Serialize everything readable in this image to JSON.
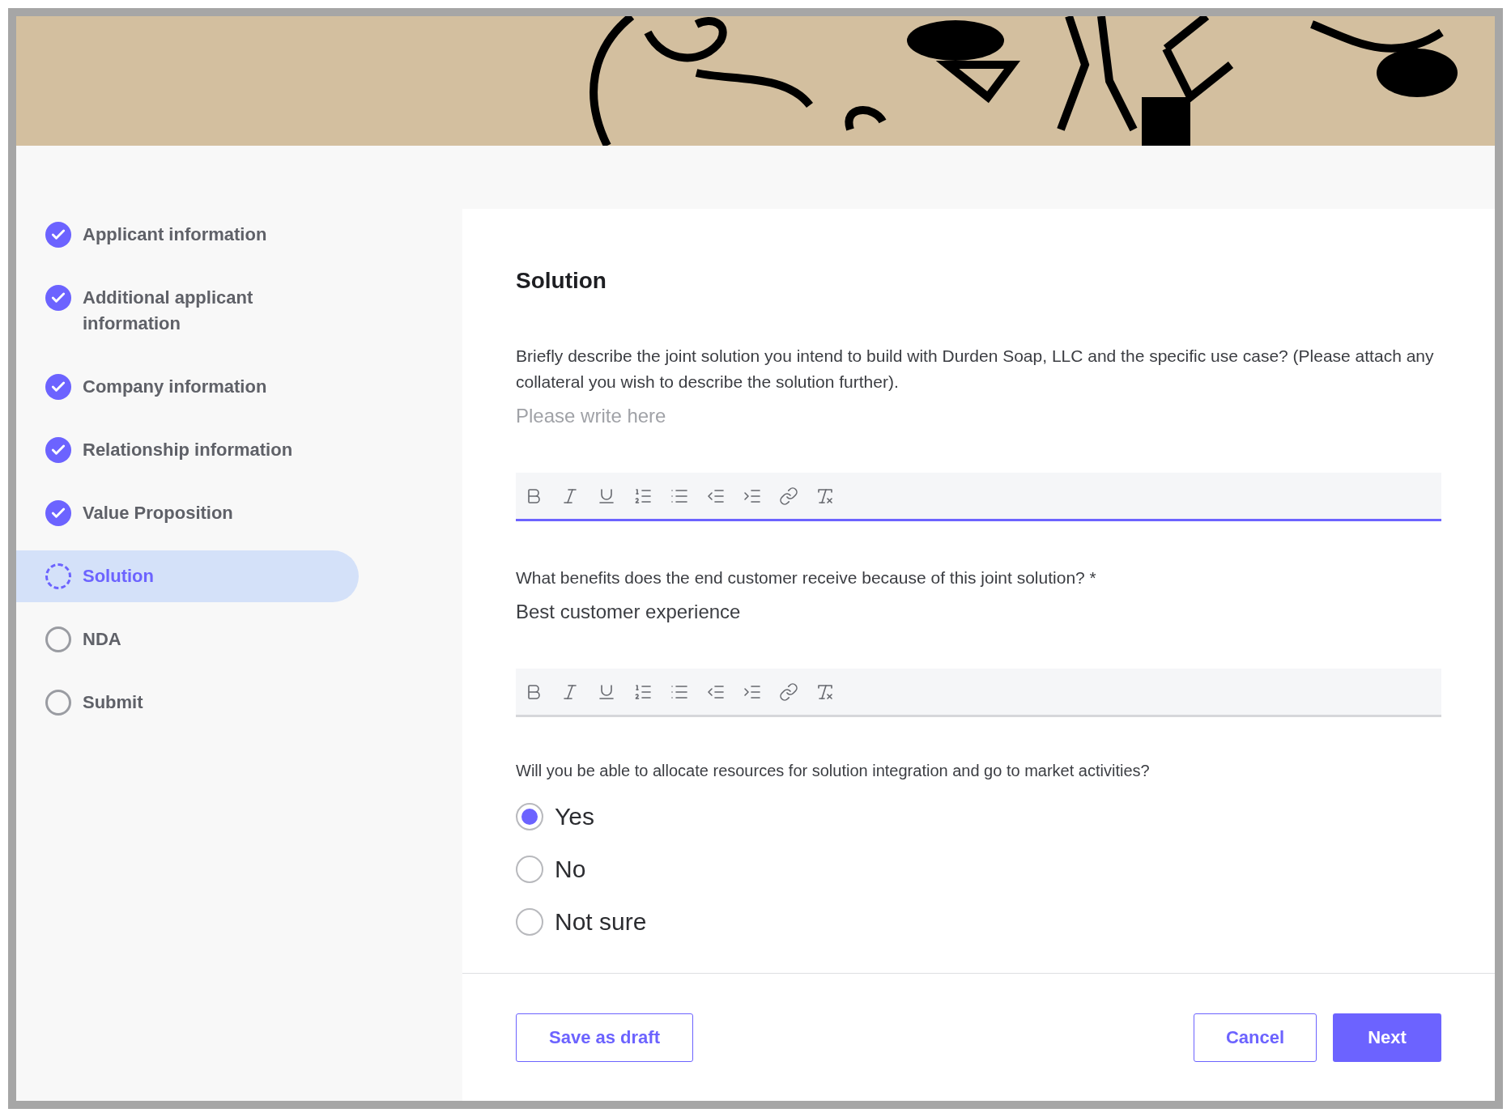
{
  "steps": [
    {
      "label": "Applicant information",
      "kind": "done",
      "selected": false
    },
    {
      "label": "Additional applicant information",
      "kind": "done",
      "selected": false
    },
    {
      "label": "Company information",
      "kind": "done",
      "selected": false
    },
    {
      "label": "Relationship information",
      "kind": "done",
      "selected": false
    },
    {
      "label": "Value Proposition",
      "kind": "done",
      "selected": false
    },
    {
      "label": "Solution",
      "kind": "current",
      "selected": true
    },
    {
      "label": "NDA",
      "kind": "todo",
      "selected": false
    },
    {
      "label": "Submit",
      "kind": "todo",
      "selected": false
    }
  ],
  "form": {
    "title": "Solution",
    "editors": [
      {
        "question": "Briefly describe the joint solution you intend to build with Durden Soap, LLC and the specific use case? (Please attach any collateral you wish to describe the solution further).",
        "placeholder": "Please write here",
        "focused": true
      },
      {
        "question": "What benefits does the end customer receive because of this joint solution? *",
        "value": "Best customer experience",
        "focused": false
      }
    ],
    "radio_question": "Will you be able to allocate resources for solution integration and go to market activities?",
    "options": [
      {
        "label": "Yes",
        "selected": true
      },
      {
        "label": "No",
        "selected": false
      },
      {
        "label": "Not sure",
        "selected": false
      }
    ]
  },
  "buttons": {
    "draft": "Save as draft",
    "cancel": "Cancel",
    "next": "Next"
  }
}
